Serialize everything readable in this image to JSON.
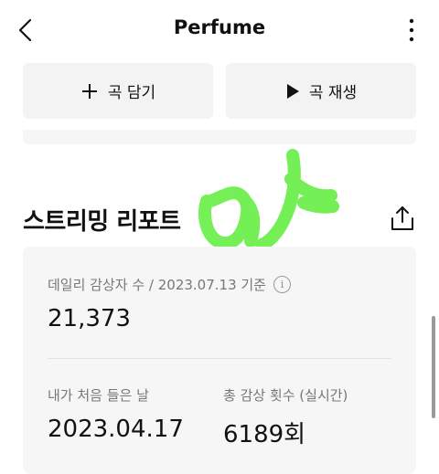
{
  "header": {
    "title": "Perfume",
    "back_icon": "chevron-left-icon",
    "more_icon": "more-vertical-icon"
  },
  "actions": {
    "add_label": "곡 담기",
    "add_icon": "plus-icon",
    "play_label": "곡 재생",
    "play_icon": "play-icon"
  },
  "report": {
    "title": "스트리밍 리포트",
    "share_icon": "share-icon",
    "daily_label": "데일리 감상자 수 / 2023.07.13 기준",
    "info_icon": "info-icon",
    "daily_value": "21,373",
    "first_listen_label": "내가 처음 들은 날",
    "first_listen_value": "2023.04.17",
    "total_plays_label": "총 감상 횟수 (실시간)",
    "total_plays_value": "6189회"
  },
  "colors": {
    "button_bg": "#f3f3f3",
    "card_bg": "#f6f6f6",
    "scribble": "#66ee44"
  }
}
